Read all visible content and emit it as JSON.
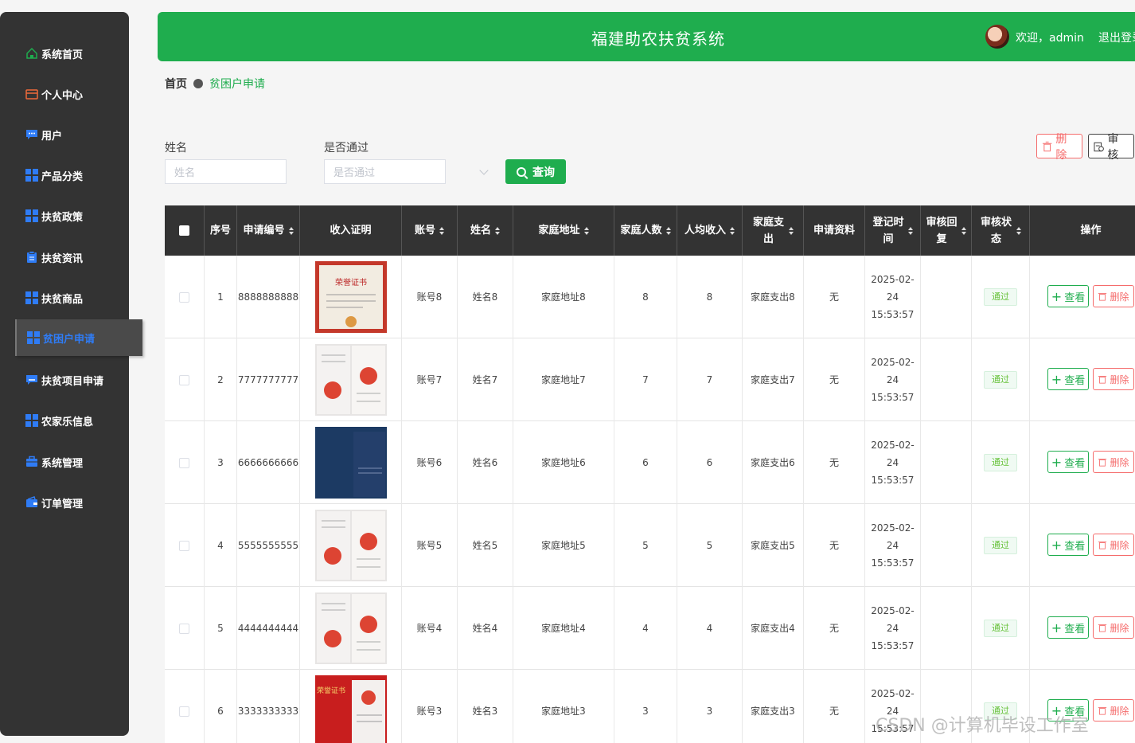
{
  "app": {
    "title": "福建助农扶贫系统",
    "welcome": "欢迎，admin",
    "logout": "退出登录"
  },
  "sidebar": {
    "items": [
      {
        "label": "系统首页",
        "icon": "home-icon"
      },
      {
        "label": "个人中心",
        "icon": "wallet-icon"
      },
      {
        "label": "用户",
        "icon": "chat-icon"
      },
      {
        "label": "产品分类",
        "icon": "grid-icon"
      },
      {
        "label": "扶贫政策",
        "icon": "grid-icon"
      },
      {
        "label": "扶贫资讯",
        "icon": "document-icon"
      },
      {
        "label": "扶贫商品",
        "icon": "grid-icon"
      },
      {
        "label": "贫困户申请",
        "icon": "grid-icon",
        "active": true
      },
      {
        "label": "扶贫项目申请",
        "icon": "chat-icon"
      },
      {
        "label": "农家乐信息",
        "icon": "grid-icon"
      },
      {
        "label": "系统管理",
        "icon": "briefcase-icon"
      },
      {
        "label": "订单管理",
        "icon": "wallet-icon"
      }
    ]
  },
  "breadcrumb": {
    "home": "首页",
    "current": "贫困户申请"
  },
  "search": {
    "name_label": "姓名",
    "name_placeholder": "姓名",
    "passed_label": "是否通过",
    "passed_placeholder": "是否通过",
    "query_button": "查询"
  },
  "toolbar": {
    "delete_label": "删除",
    "audit_label": "审核"
  },
  "table": {
    "headers": {
      "index": "序号",
      "app_no": "申请编号",
      "income_proof": "收入证明",
      "account": "账号",
      "name": "姓名",
      "address": "家庭地址",
      "family_size": "家庭人数",
      "per_capita_income": "人均收入",
      "expense": "家庭支出",
      "materials": "申请资料",
      "reg_time": "登记时间",
      "audit_reply": "审核回复",
      "audit_status": "审核状态",
      "actions": "操作"
    },
    "view_label": "查看",
    "delete_label": "删除",
    "rows": [
      {
        "index": "1",
        "app_no": "8888888888",
        "account": "账号8",
        "name": "姓名8",
        "address": "家庭地址8",
        "family_size": "8",
        "per_capita_income": "8",
        "expense": "家庭支出8",
        "materials": "无",
        "reg_date": "2025-02-24",
        "reg_clock": "15:53:57",
        "audit_reply": "",
        "status": "通过",
        "thumb": "certificate-red-title"
      },
      {
        "index": "2",
        "app_no": "7777777777",
        "account": "账号7",
        "name": "姓名7",
        "address": "家庭地址7",
        "family_size": "7",
        "per_capita_income": "7",
        "expense": "家庭支出7",
        "materials": "无",
        "reg_date": "2025-02-24",
        "reg_clock": "15:53:57",
        "audit_reply": "",
        "status": "通过",
        "thumb": "certificate-open"
      },
      {
        "index": "3",
        "app_no": "6666666666",
        "account": "账号6",
        "name": "姓名6",
        "address": "家庭地址6",
        "family_size": "6",
        "per_capita_income": "6",
        "expense": "家庭支出6",
        "materials": "无",
        "reg_date": "2025-02-24",
        "reg_clock": "15:53:57",
        "audit_reply": "",
        "status": "通过",
        "thumb": "certificate-blue"
      },
      {
        "index": "4",
        "app_no": "5555555555",
        "account": "账号5",
        "name": "姓名5",
        "address": "家庭地址5",
        "family_size": "5",
        "per_capita_income": "5",
        "expense": "家庭支出5",
        "materials": "无",
        "reg_date": "2025-02-24",
        "reg_clock": "15:53:57",
        "audit_reply": "",
        "status": "通过",
        "thumb": "certificate-open"
      },
      {
        "index": "5",
        "app_no": "4444444444",
        "account": "账号4",
        "name": "姓名4",
        "address": "家庭地址4",
        "family_size": "4",
        "per_capita_income": "4",
        "expense": "家庭支出4",
        "materials": "无",
        "reg_date": "2025-02-24",
        "reg_clock": "15:53:57",
        "audit_reply": "",
        "status": "通过",
        "thumb": "certificate-open"
      },
      {
        "index": "6",
        "app_no": "3333333333",
        "account": "账号3",
        "name": "姓名3",
        "address": "家庭地址3",
        "family_size": "3",
        "per_capita_income": "3",
        "expense": "家庭支出3",
        "materials": "无",
        "reg_date": "2025-02-24",
        "reg_clock": "15:53:57",
        "audit_reply": "",
        "status": "通过",
        "thumb": "certificate-red"
      }
    ]
  },
  "watermark": "CSDN @计算机毕设工作室",
  "colors": {
    "brand_green": "#1fad4e",
    "sidebar_bg": "#333333",
    "danger": "#f56c6c",
    "active_blue": "#2f7cf6"
  }
}
